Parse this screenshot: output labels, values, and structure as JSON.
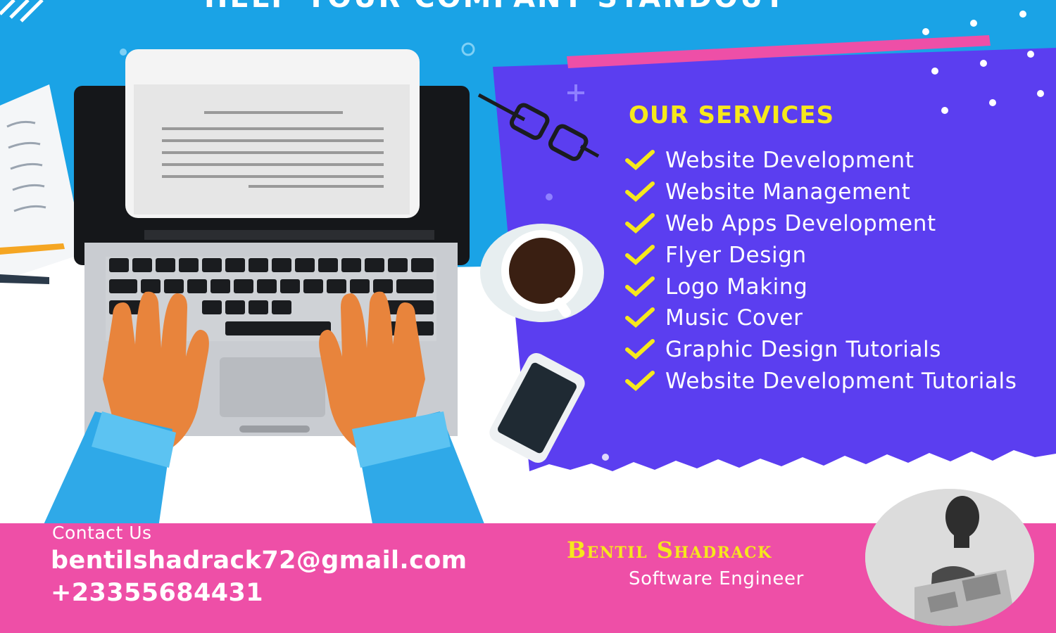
{
  "headline": "HELP YOUR COMPANY STANDOUT",
  "services": {
    "title": "OUR SERVICES",
    "items": [
      "Website Development",
      "Website Management",
      "Web Apps Development",
      "Flyer Design",
      "Logo Making",
      "Music Cover",
      "Graphic Design Tutorials",
      "Website Development Tutorials"
    ]
  },
  "contact": {
    "label": "Contact Us",
    "email": "bentilshadrack72@gmail.com",
    "phone": "+23355684431"
  },
  "person": {
    "name": "Bentil Shadrack",
    "role": "Software Engineer"
  },
  "colors": {
    "sky": "#1aa3e6",
    "panel": "#5b3ef0",
    "accent_pink": "#ee4fa7",
    "accent_yellow": "#f6e81c"
  },
  "icons": [
    "check-icon",
    "laptop-illustration",
    "glasses-icon",
    "coffee-cup-icon",
    "phone-icon",
    "avatar"
  ]
}
